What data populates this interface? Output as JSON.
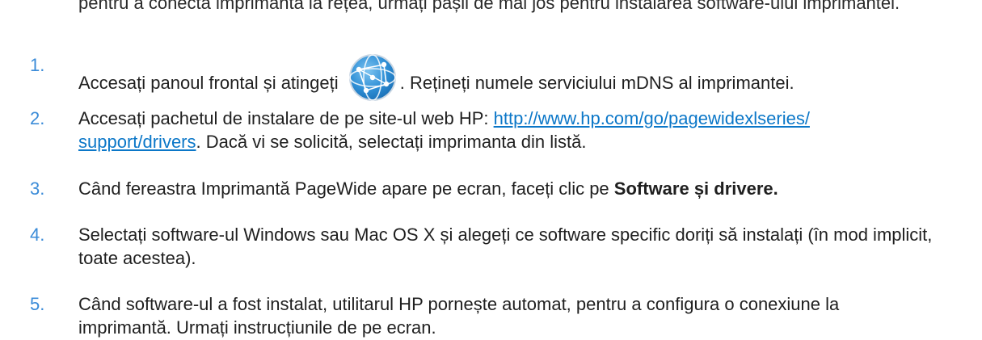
{
  "top_cut_text": "pentru a conecta imprimanta la rețea, urmați pașii de mai jos pentru instalarea software-ului imprimantei.",
  "steps": [
    {
      "num": "1.",
      "before_icon": "Accesați panoul frontal și atingeți",
      "icon": "network-globe-icon",
      "after_icon": ". Rețineți numele serviciului mDNS al imprimantei."
    },
    {
      "num": "2.",
      "text_before_link": "Accesați pachetul de instalare de pe site-ul web HP: ",
      "link_line1": "http://www.hp.com/go/pagewidexlseries/",
      "link_line2": "support/drivers",
      "text_after_link": ". Dacă vi se solicită, selectați imprimanta din listă."
    },
    {
      "num": "3.",
      "text": "Când fereastra Imprimantă PageWide apare pe ecran, faceți clic pe ",
      "bold": "Software și drivere."
    },
    {
      "num": "4.",
      "line1": "Selectați software-ul Windows sau Mac OS X și alegeți ce software specific doriți să instalați (în mod implicit,",
      "line2": "toate acestea)."
    },
    {
      "num": "5.",
      "line1": "Când software-ul a fost instalat, utilitarul HP pornește automat, pentru a configura o conexiune la",
      "line2": "imprimantă. Urmați instrucțiunile de pe ecran."
    }
  ],
  "colors": {
    "number": "#3a8bd8",
    "link": "#0b77c8",
    "text": "#1f1f1f"
  }
}
